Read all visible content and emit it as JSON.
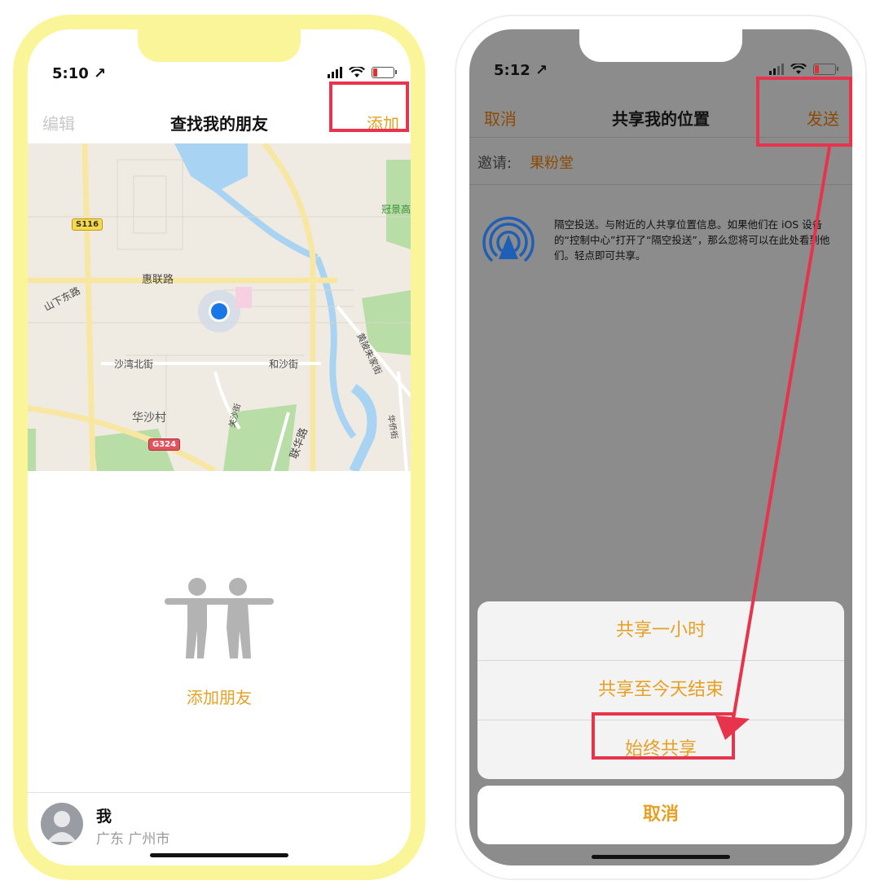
{
  "colors": {
    "accent": "#e6a125",
    "highlight": "#e8334d",
    "left_frame": "#fbf59a"
  },
  "left_phone": {
    "status": {
      "time": "5:10 ↗"
    },
    "nav": {
      "edit": "编辑",
      "title": "查找我的朋友",
      "add": "添加"
    },
    "map": {
      "labels": {
        "s116": "S116",
        "huilian_road": "惠联路",
        "shanxia_east": "山下东路",
        "guanjing": "冠景高",
        "shawan_north": "沙湾北街",
        "heshajie": "和沙街",
        "huasha_village": "华沙村",
        "g324": "G324",
        "lianhua_road": "联华路",
        "guanshajie": "关沙街",
        "road_right": "黄陂朱家街",
        "huaqiao": "华侨街"
      }
    },
    "empty_state": {
      "add_friend": "添加朋友",
      "icon": "friends-icon"
    },
    "me": {
      "name": "我",
      "location": "广东 广州市"
    }
  },
  "right_phone": {
    "status": {
      "time": "5:12 ↗"
    },
    "nav": {
      "cancel": "取消",
      "title": "共享我的位置",
      "send": "发送"
    },
    "invite": {
      "label": "邀请:",
      "value": "果粉堂"
    },
    "airdrop": {
      "icon": "airdrop-icon",
      "text": "隔空投送。与附近的人共享位置信息。如果他们在 iOS 设备的“控制中心”打开了“隔空投送”，那么您将可以在此处看到他们。轻点即可共享。"
    },
    "sheet": {
      "options": [
        "共享一小时",
        "共享至今天结束",
        "始终共享"
      ],
      "cancel": "取消"
    }
  }
}
